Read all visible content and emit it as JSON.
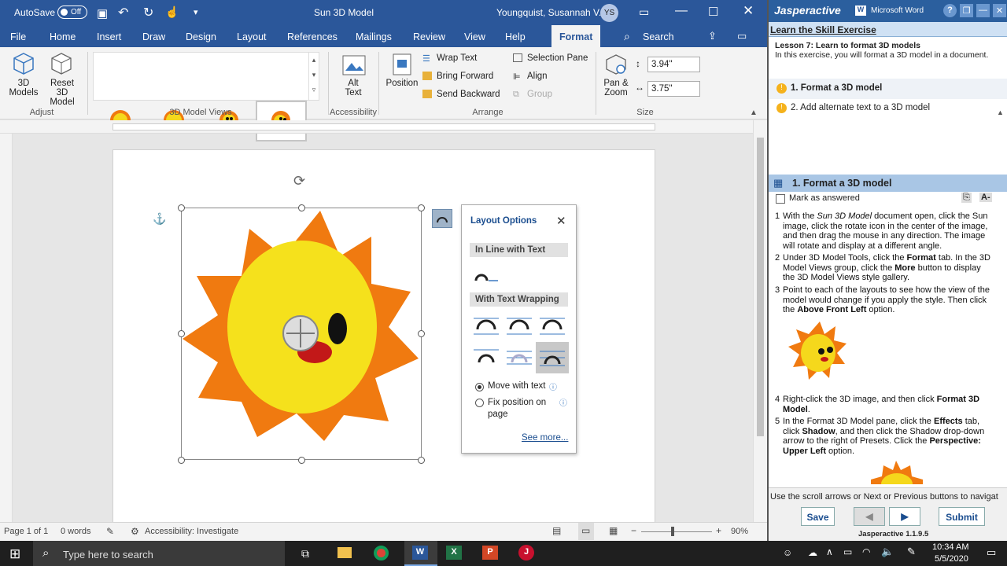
{
  "title": {
    "autosave": "AutoSave",
    "autosave_state": "Off",
    "doc": "Sun 3D Model",
    "user": "Youngquist, Susannah V.",
    "initials": "YS"
  },
  "tabs": [
    "File",
    "Home",
    "Insert",
    "Draw",
    "Design",
    "Layout",
    "References",
    "Mailings",
    "Review",
    "View",
    "Help",
    "Format"
  ],
  "search": "Search",
  "ribbon": {
    "models3d": "3D Models",
    "reset": "Reset 3D Model",
    "adjust": "Adjust",
    "views": "3D Model Views",
    "alt": "Alt Text",
    "accessibility": "Accessibility",
    "position": "Position",
    "wrap": "Wrap Text",
    "bring": "Bring Forward",
    "send": "Send Backward",
    "selpane": "Selection Pane",
    "align": "Align",
    "group": "Group",
    "arrange": "Arrange",
    "pan": "Pan & Zoom",
    "height": "3.94\"",
    "width": "3.75\"",
    "size": "Size"
  },
  "layout": {
    "title": "Layout Options",
    "inline": "In Line with Text",
    "wrapping": "With Text Wrapping",
    "move": "Move with text",
    "fix": "Fix position on page",
    "more": "See more..."
  },
  "status": {
    "page": "Page 1 of 1",
    "words": "0 words",
    "access": "Accessibility: Investigate",
    "zoom": "90%"
  },
  "taskbar": {
    "search": "Type here to search",
    "time": "10:34 AM",
    "date": "5/5/2020"
  },
  "panel": {
    "brand": "Jasperactive",
    "product": "Microsoft Word",
    "learn": "Learn the Skill Exercise",
    "lesson": "Lesson 7: Learn to format 3D models",
    "lesson_desc": "In this exercise, you will format a 3D model in a document.",
    "task1": "1. Format a 3D model",
    "task2": "2. Add alternate text to a 3D model",
    "section": "1. Format a 3D model",
    "mark": "Mark as answered",
    "footer": "Use the scroll arrows or Next or Previous buttons to navigat",
    "save": "Save",
    "submit": "Submit",
    "version": "Jasperactive 1.1.9.5"
  },
  "colors": {
    "word_blue": "#2b579a",
    "panel_blue": "#2b5f9e",
    "sun_orange": "#f07a10",
    "sun_yellow": "#f5e11c"
  }
}
